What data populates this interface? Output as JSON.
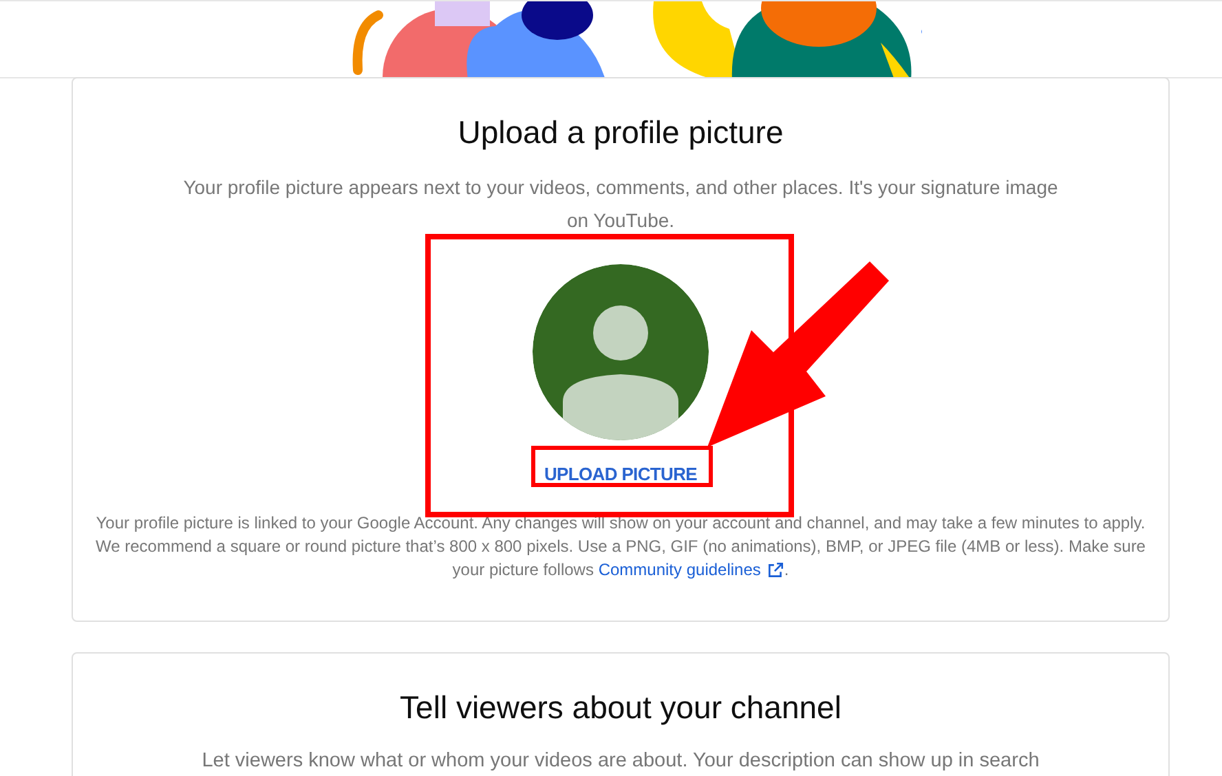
{
  "profile_picture": {
    "title": "Upload a profile picture",
    "description": "Your profile picture appears next to your videos, comments, and other places. It's your signature image on YouTube.",
    "upload_button": "UPLOAD PICTURE",
    "note": "Your profile picture is linked to your Google Account. Any changes will show on your account and channel, and may take a few minutes to apply. We recommend a square or round picture that’s 800 x 800 pixels. Use a PNG, GIF (no animations), BMP, or JPEG file (4MB or less). Make sure your picture follows",
    "link": "Community guidelines",
    "note_end": "."
  },
  "description_section": {
    "title": "Tell viewers about your channel",
    "description": "Let viewers know what or whom your videos are about. Your description can show up in search"
  }
}
